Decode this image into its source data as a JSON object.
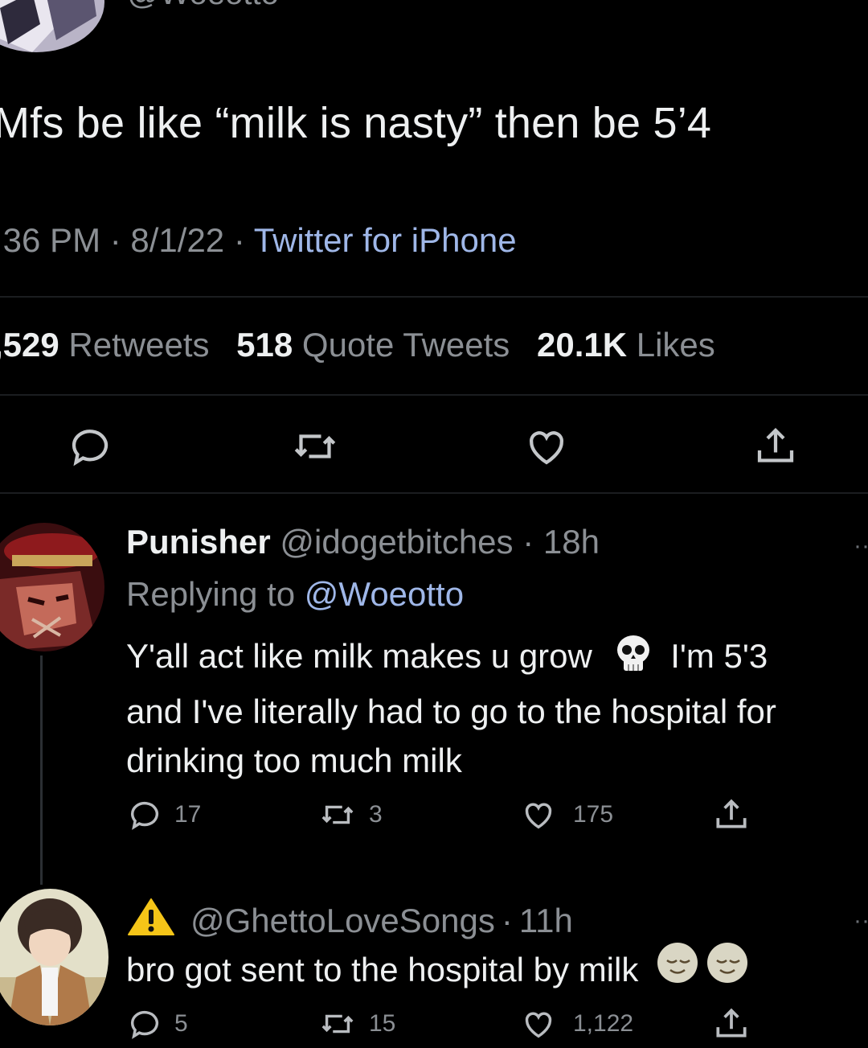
{
  "main_tweet": {
    "handle_partial": "@Woeotto",
    "text": "Mfs be like “milk is nasty” then be 5’4",
    "time": ":36 PM",
    "date": "8/1/22",
    "source": "Twitter for iPhone",
    "stats": {
      "retweets_count": ",529",
      "retweets_label": "Retweets",
      "quotes_count": "518",
      "quotes_label": "Quote Tweets",
      "likes_count": "20.1K",
      "likes_label": "Likes"
    },
    "actions": [
      "reply-icon",
      "retweet-icon",
      "like-icon",
      "share-icon"
    ]
  },
  "reply1": {
    "name": "Punisher",
    "handle": "@idogetbitches",
    "time": "18h",
    "replying_prefix": "Replying to",
    "replying_to": "@Woeotto",
    "text_line1": "Y'all act like milk makes u grow",
    "emoji": "skull",
    "text_line1_end": "I'm 5'3",
    "text_line2": "and I've literally had to go to the hospital for",
    "text_line3": "drinking too much milk",
    "reply_count": "17",
    "retweet_count": "3",
    "like_count": "175",
    "more": "··"
  },
  "reply2": {
    "name_icon": "warning-icon",
    "handle": "@GhettoLoveSongs",
    "time": "11h",
    "text": "bro got sent to the hospital by milk",
    "emojis": [
      "relieved-face",
      "relieved-face"
    ],
    "reply_count": "5",
    "retweet_count": "15",
    "like_count": "1,122",
    "more": "··"
  },
  "colors": {
    "background": "#000000",
    "text": "#eef0f1",
    "muted": "#8b8f94",
    "link": "#9fb7e8"
  }
}
